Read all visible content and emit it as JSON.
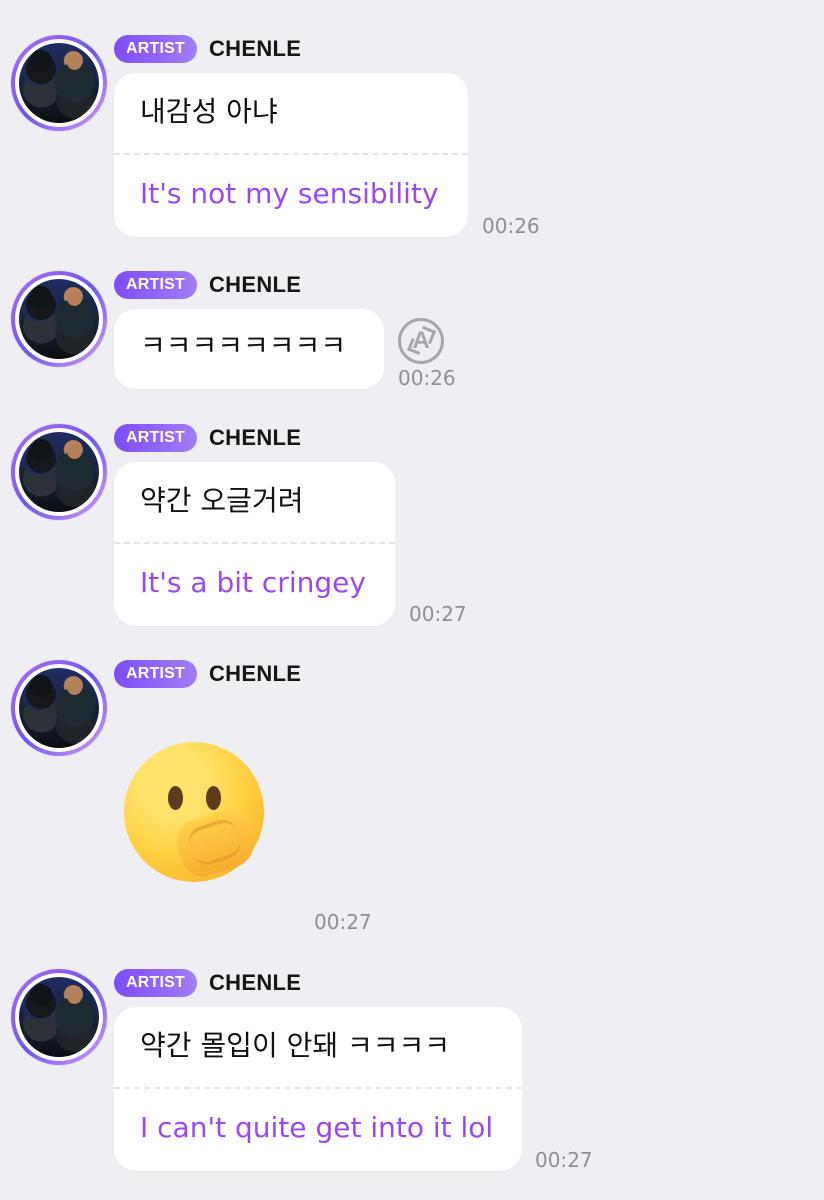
{
  "chat": {
    "messages": [
      {
        "badge": "ARTIST",
        "author": "CHENLE",
        "text_ko": "내감성 아냐",
        "text_en": "It's not my sensibility",
        "time": "00:26"
      },
      {
        "badge": "ARTIST",
        "author": "CHENLE",
        "text_ko": "ㅋㅋㅋㅋㅋㅋㅋㅋ",
        "translate_icon": "translate-icon",
        "translate_label": "A",
        "time": "00:26"
      },
      {
        "badge": "ARTIST",
        "author": "CHENLE",
        "text_ko": "약간 오글거려",
        "text_en": "It's a bit cringey",
        "time": "00:27"
      },
      {
        "badge": "ARTIST",
        "author": "CHENLE",
        "emoji": "🫢",
        "time": "00:27"
      },
      {
        "badge": "ARTIST",
        "author": "CHENLE",
        "text_ko": "약간 몰입이 안돼 ㅋㅋㅋㅋ",
        "text_en": "I can't quite get into it lol",
        "time": "00:27"
      }
    ]
  },
  "colors": {
    "background": "#efeef2",
    "bubble": "#ffffff",
    "translation": "#9a49f0",
    "badge_start": "#7d4df7",
    "badge_end": "#a17ef4",
    "timestamp": "#8f8f95"
  },
  "icons": {
    "avatar": "avatar-icon",
    "translate": "translate-icon",
    "emoji": "hand-over-mouth-emoji"
  }
}
